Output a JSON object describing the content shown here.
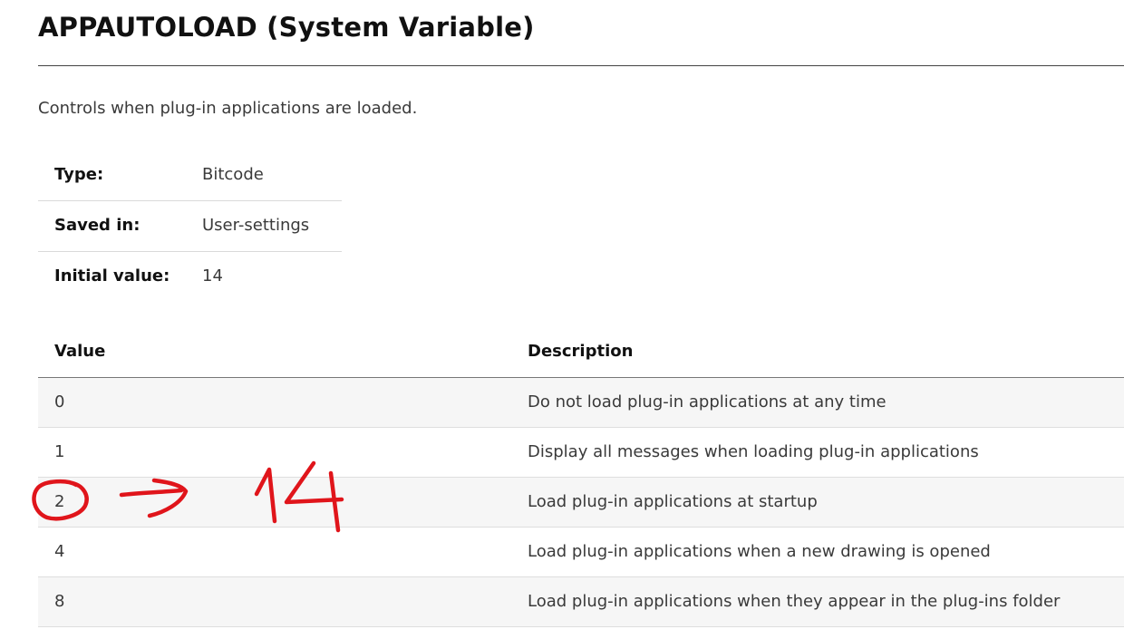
{
  "page": {
    "title": "APPAUTOLOAD (System Variable)",
    "summary": "Controls when plug-in applications are loaded."
  },
  "properties": [
    {
      "label": "Type:",
      "value": "Bitcode"
    },
    {
      "label": "Saved in:",
      "value": "User-settings"
    },
    {
      "label": "Initial value:",
      "value": "14"
    }
  ],
  "values_table": {
    "headers": {
      "value": "Value",
      "description": "Description"
    },
    "rows": [
      {
        "value": "0",
        "description": "Do not load plug-in applications at any time"
      },
      {
        "value": "1",
        "description": "Display all messages when loading plug-in applications"
      },
      {
        "value": "2",
        "description": "Load plug-in applications at startup"
      },
      {
        "value": "4",
        "description": "Load plug-in applications when a new drawing is opened"
      },
      {
        "value": "8",
        "description": "Load plug-in applications when they appear in the plug-ins folder"
      }
    ]
  },
  "annotation": {
    "handwritten_text": "14",
    "color": "#e0151b"
  },
  "colors": {
    "text": "#3a3a3a",
    "heading": "#111111",
    "row_shade": "#f6f6f6",
    "annotation_red": "#e0151b"
  }
}
